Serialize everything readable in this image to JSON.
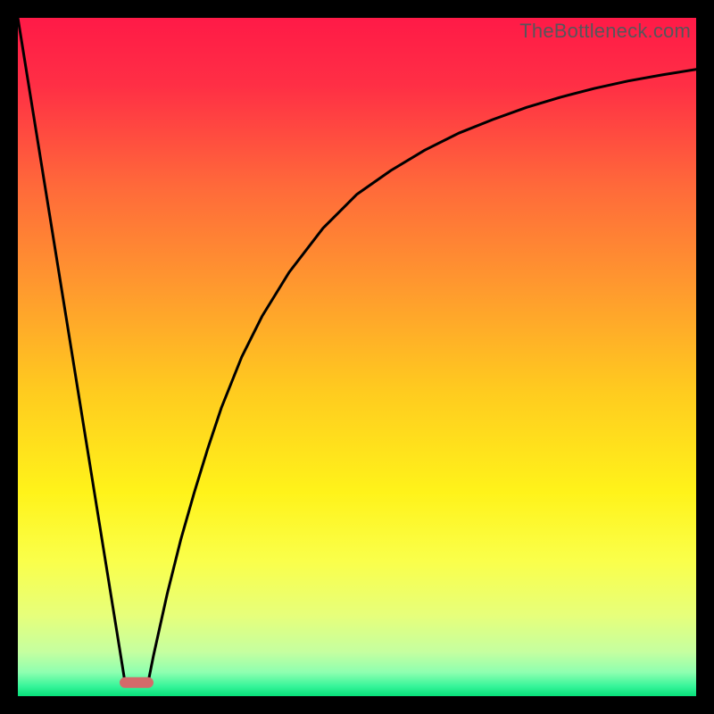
{
  "watermark": "TheBottleneck.com",
  "chart_data": {
    "type": "line",
    "title": "",
    "xlabel": "",
    "ylabel": "",
    "xrange": [
      0,
      100
    ],
    "yrange": [
      0,
      100
    ],
    "grid": false,
    "legend": false,
    "background_gradient": {
      "stops": [
        {
          "offset": 0.0,
          "color": "#ff1a47"
        },
        {
          "offset": 0.1,
          "color": "#ff2f45"
        },
        {
          "offset": 0.25,
          "color": "#ff6a3a"
        },
        {
          "offset": 0.4,
          "color": "#ff9a2e"
        },
        {
          "offset": 0.55,
          "color": "#ffcb1f"
        },
        {
          "offset": 0.7,
          "color": "#fff31a"
        },
        {
          "offset": 0.8,
          "color": "#faff4a"
        },
        {
          "offset": 0.88,
          "color": "#e7ff7a"
        },
        {
          "offset": 0.935,
          "color": "#c5ffa0"
        },
        {
          "offset": 0.965,
          "color": "#8effb0"
        },
        {
          "offset": 0.985,
          "color": "#38f59a"
        },
        {
          "offset": 1.0,
          "color": "#07e07a"
        }
      ]
    },
    "optimal_marker": {
      "x_center": 17.5,
      "x_left": 15.0,
      "x_right": 20.0,
      "y": 2.0,
      "color": "#d46a6a"
    },
    "series": [
      {
        "name": "bottleneck-left",
        "color": "#000000",
        "x": [
          0,
          1,
          2,
          3,
          4,
          5,
          6,
          7,
          8,
          9,
          10,
          11,
          12,
          13,
          14,
          15,
          15.8
        ],
        "y": [
          100,
          93.8,
          87.6,
          81.4,
          75.2,
          69.0,
          62.8,
          56.6,
          50.4,
          44.2,
          38.0,
          31.8,
          25.6,
          19.4,
          13.2,
          7.0,
          2.0
        ]
      },
      {
        "name": "bottleneck-right",
        "color": "#000000",
        "x": [
          19.2,
          20,
          22,
          24,
          26,
          28,
          30,
          33,
          36,
          40,
          45,
          50,
          55,
          60,
          65,
          70,
          75,
          80,
          85,
          90,
          95,
          100
        ],
        "y": [
          2.0,
          6.0,
          15.0,
          23.0,
          30.0,
          36.5,
          42.5,
          50.0,
          56.0,
          62.5,
          69.0,
          74.0,
          77.5,
          80.5,
          83.0,
          85.0,
          86.8,
          88.3,
          89.6,
          90.7,
          91.6,
          92.4
        ]
      }
    ]
  }
}
